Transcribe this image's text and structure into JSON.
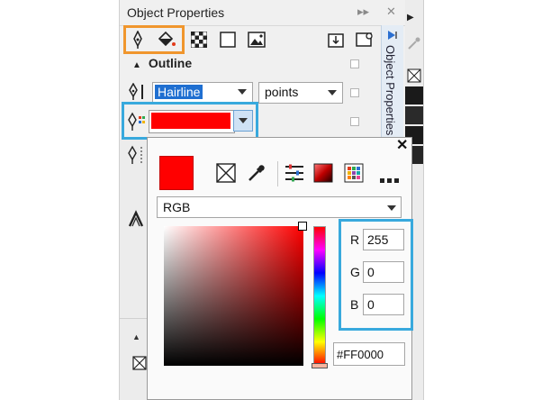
{
  "panel": {
    "title": "Object Properties",
    "controls": [
      "▸▸",
      "✕"
    ]
  },
  "section": {
    "label": "Outline",
    "collapse_glyph": "▲"
  },
  "outline": {
    "width_value": "Hairline",
    "units_value": "points",
    "color": "#ff0000"
  },
  "side_tab": {
    "label": "Object Properties"
  },
  "popup": {
    "close_glyph": "✕",
    "current_color": "#ff0000",
    "color_model": "RGB",
    "channels": [
      {
        "label": "R",
        "value": "255"
      },
      {
        "label": "G",
        "value": "0"
      },
      {
        "label": "B",
        "value": "0"
      }
    ],
    "hex_value": "#FF0000"
  },
  "colors": {
    "accent_orange": "#f0962d",
    "accent_blue": "#38a9dd",
    "selection": "#1f6fd1"
  }
}
